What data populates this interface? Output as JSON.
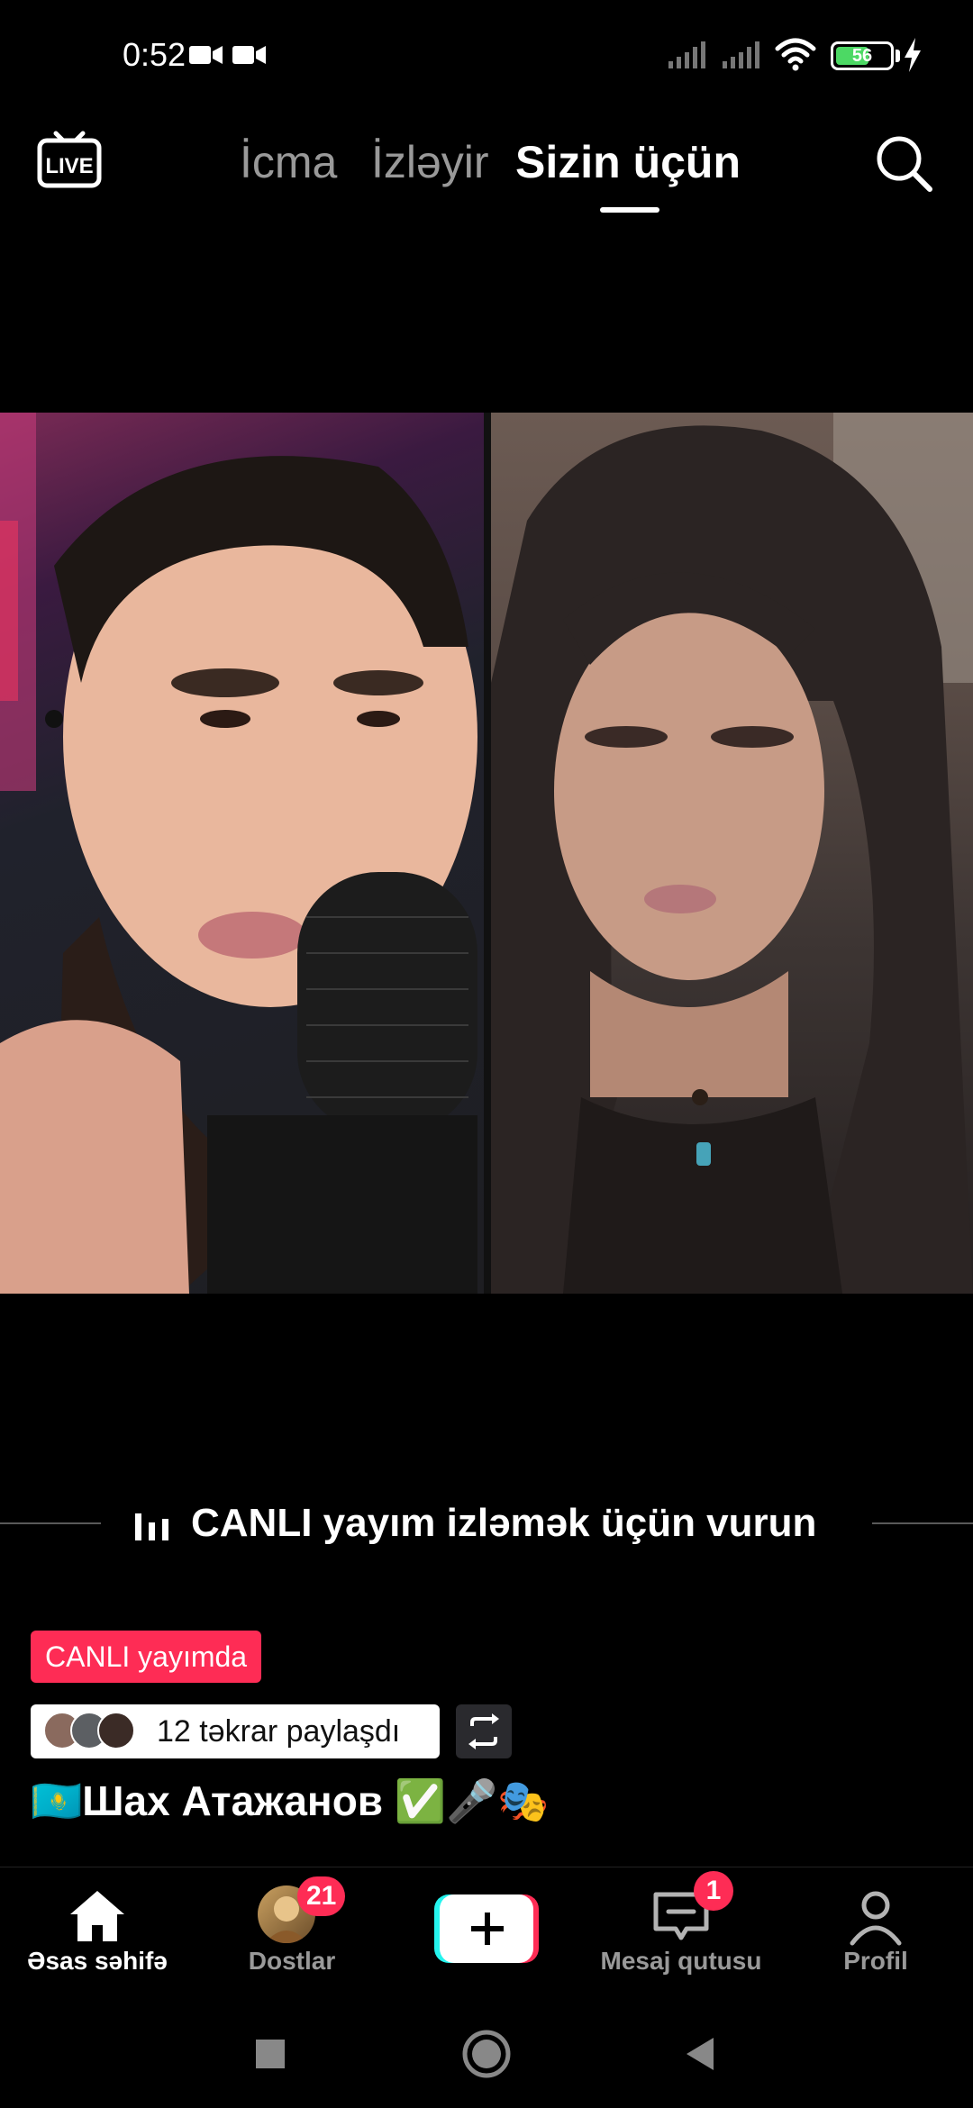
{
  "status_bar": {
    "time": "0:52",
    "battery_level": "56",
    "icons": [
      "video-camera-icon",
      "video-camera-icon",
      "signal-icon",
      "signal-icon",
      "wifi-icon",
      "battery-icon",
      "charging-bolt-icon"
    ]
  },
  "top_nav": {
    "live_icon": "live-tv-icon",
    "tabs": [
      {
        "label": "İcma",
        "active": false
      },
      {
        "label": "İzləyir",
        "active": false
      },
      {
        "label": "Sizin üçün",
        "active": true
      }
    ],
    "search_icon": "search-icon"
  },
  "live": {
    "prompt": "CANLI yayım izləmək üçün vurun",
    "badge": "CANLI yayımda",
    "repost_text": "12 təkrar paylaşdı",
    "title": "🇰🇿Шах Атажанов ✅🎤🎭"
  },
  "bottom_nav": {
    "items": [
      {
        "label": "Əsas səhifə",
        "icon": "home-icon",
        "active": true
      },
      {
        "label": "Dostlar",
        "icon": "friends-avatar-icon",
        "badge": "21",
        "active": false
      },
      {
        "label": "",
        "icon": "plus-icon",
        "active": false
      },
      {
        "label": "Mesaj qutusu",
        "icon": "inbox-icon",
        "badge": "1",
        "active": false
      },
      {
        "label": "Profil",
        "icon": "profile-icon",
        "active": false
      }
    ]
  },
  "colors": {
    "accent": "#fe2c55",
    "cyan": "#25f4ee",
    "background": "#000000"
  }
}
